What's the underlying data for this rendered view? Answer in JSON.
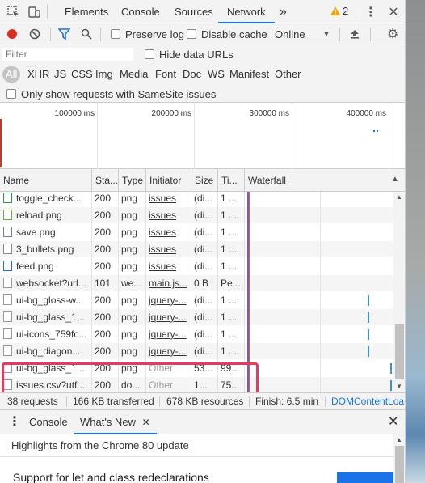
{
  "tabs": {
    "elements": "Elements",
    "console": "Console",
    "sources": "Sources",
    "network": "Network",
    "more": "»",
    "warning_count": "2"
  },
  "toolbar": {
    "preserve_log": "Preserve log",
    "disable_cache": "Disable cache",
    "throttle": "Online"
  },
  "filter": {
    "placeholder": "Filter",
    "hide_data_urls": "Hide data URLs",
    "types": [
      "All",
      "XHR",
      "JS",
      "CSS",
      "Img",
      "Media",
      "Font",
      "Doc",
      "WS",
      "Manifest",
      "Other"
    ],
    "samesite": "Only show requests with SameSite issues"
  },
  "overview": {
    "ticks": [
      "100000 ms",
      "200000 ms",
      "300000 ms",
      "400000 ms"
    ]
  },
  "table": {
    "headers": [
      "Name",
      "Sta...",
      "Type",
      "Initiator",
      "Size",
      "Ti...",
      "Waterfall"
    ],
    "rows": [
      {
        "name": "toggle_check...",
        "status": "200",
        "type": "png",
        "initiator": "issues",
        "size": "(di...",
        "time": "1 ...",
        "icon": "check-image-icon"
      },
      {
        "name": "reload.png",
        "status": "200",
        "type": "png",
        "initiator": "issues",
        "size": "(di...",
        "time": "1 ...",
        "icon": "reload-image-icon"
      },
      {
        "name": "save.png",
        "status": "200",
        "type": "png",
        "initiator": "issues",
        "size": "(di...",
        "time": "1 ...",
        "icon": "save-image-icon"
      },
      {
        "name": "3_bullets.png",
        "status": "200",
        "type": "png",
        "initiator": "issues",
        "size": "(di...",
        "time": "1 ...",
        "icon": "bullets-image-icon"
      },
      {
        "name": "feed.png",
        "status": "200",
        "type": "png",
        "initiator": "issues",
        "size": "(di...",
        "time": "1 ...",
        "icon": "feed-image-icon"
      },
      {
        "name": "websocket?url...",
        "status": "101",
        "type": "we...",
        "initiator": "main.js...",
        "size": "0 B",
        "time": "Pe...",
        "icon": "websocket-icon"
      },
      {
        "name": "ui-bg_gloss-w...",
        "status": "200",
        "type": "png",
        "initiator": "jquery-...",
        "size": "(di...",
        "time": "1 ...",
        "icon": "image-file-icon"
      },
      {
        "name": "ui-bg_glass_1...",
        "status": "200",
        "type": "png",
        "initiator": "jquery-...",
        "size": "(di...",
        "time": "1 ...",
        "icon": "image-file-icon"
      },
      {
        "name": "ui-icons_759fc...",
        "status": "200",
        "type": "png",
        "initiator": "jquery-...",
        "size": "(di...",
        "time": "1 ...",
        "icon": "image-file-icon"
      },
      {
        "name": "ui-bg_diagon...",
        "status": "200",
        "type": "png",
        "initiator": "jquery-...",
        "size": "(di...",
        "time": "1 ...",
        "icon": "image-file-icon"
      },
      {
        "name": "ui-bg_glass_1...",
        "status": "200",
        "type": "png",
        "initiator": "Other",
        "size": "53...",
        "time": "99...",
        "icon": "image-file-icon"
      },
      {
        "name": "issues.csv?utf...",
        "status": "200",
        "type": "do...",
        "initiator": "Other",
        "size": "1...",
        "time": "75...",
        "icon": "document-file-icon"
      }
    ]
  },
  "status": {
    "requests": "38 requests",
    "transferred": "166 KB transferred",
    "resources": "678 KB resources",
    "finish": "Finish: 6.5 min",
    "dcl": "DOMContentLoa"
  },
  "drawer": {
    "console": "Console",
    "whats_new": "What's New",
    "highlights": "Highlights from the Chrome 80 update",
    "feature_title": "Support for let and class redeclarations"
  },
  "colors": {
    "accent": "#1a73e8",
    "record": "#d93025",
    "highlight": "#e83a5e"
  }
}
